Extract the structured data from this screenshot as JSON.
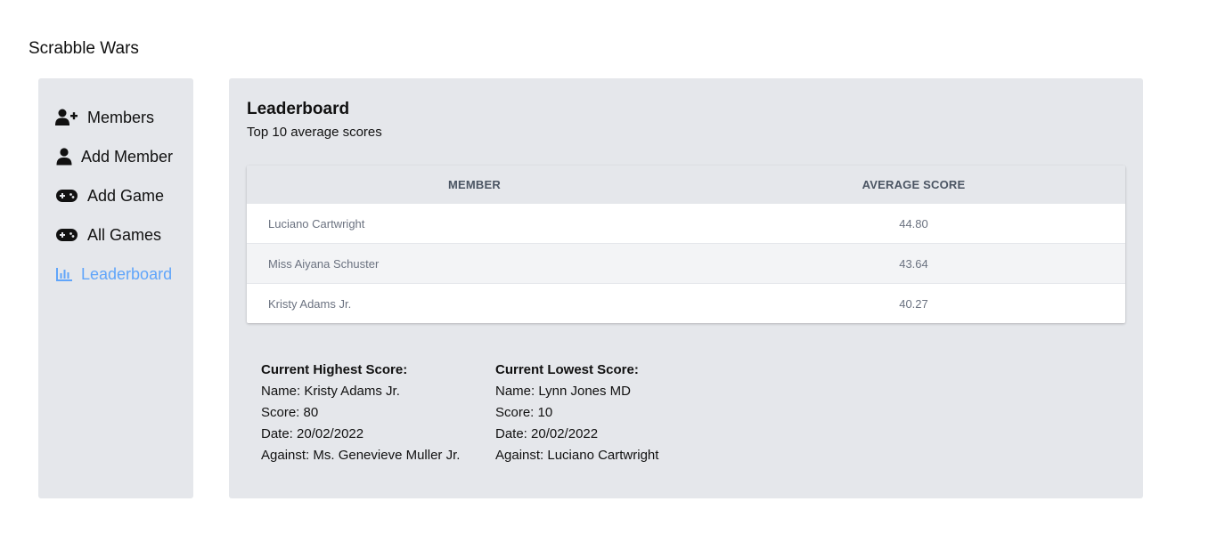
{
  "app": {
    "title": "Scrabble Wars"
  },
  "sidebar": {
    "items": [
      {
        "label": "Members",
        "icon": "user-plus-icon",
        "active": false
      },
      {
        "label": "Add Member",
        "icon": "user-icon",
        "active": false
      },
      {
        "label": "Add Game",
        "icon": "gamepad-icon",
        "active": false
      },
      {
        "label": "All Games",
        "icon": "gamepad-icon",
        "active": false
      },
      {
        "label": "Leaderboard",
        "icon": "bar-chart-icon",
        "active": true
      }
    ]
  },
  "main": {
    "title": "Leaderboard",
    "subtitle": "Top 10 average scores",
    "table": {
      "headers": {
        "member": "MEMBER",
        "average_score": "AVERAGE SCORE"
      },
      "rows": [
        {
          "member": "Luciano Cartwright",
          "average_score": "44.80"
        },
        {
          "member": "Miss Aiyana Schuster",
          "average_score": "43.64"
        },
        {
          "member": "Kristy Adams Jr.",
          "average_score": "40.27"
        }
      ]
    },
    "highest": {
      "heading": "Current Highest Score:",
      "name": "Name: Kristy Adams Jr.",
      "score": "Score: 80",
      "date": "Date: 20/02/2022",
      "against": "Against: Ms. Genevieve Muller Jr."
    },
    "lowest": {
      "heading": "Current Lowest Score:",
      "name": "Name: Lynn Jones MD",
      "score": "Score: 10",
      "date": "Date: 20/02/2022",
      "against": "Against: Luciano Cartwright"
    }
  },
  "colors": {
    "accent": "#60a5fa",
    "panel": "#e5e7eb",
    "row_alt": "#f3f4f6"
  }
}
